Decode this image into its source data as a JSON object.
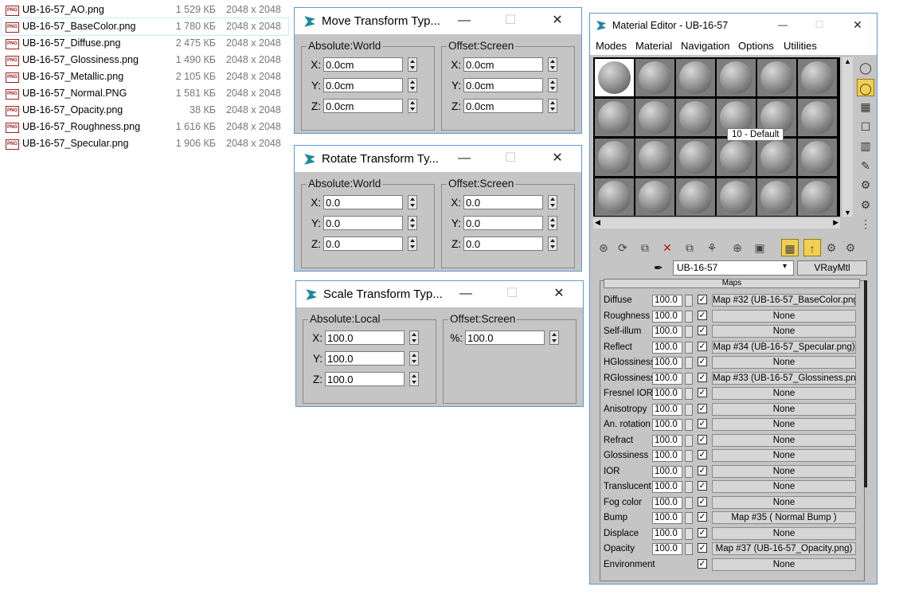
{
  "files": [
    {
      "icon": "png-file-icon",
      "name": "UB-16-57_AO.png",
      "size": "1 529 КБ",
      "dim": "2048 x 2048"
    },
    {
      "icon": "png-file-icon",
      "name": "UB-16-57_BaseColor.png",
      "size": "1 780 КБ",
      "dim": "2048 x 2048"
    },
    {
      "icon": "png-file-icon",
      "name": "UB-16-57_Diffuse.png",
      "size": "2 475 КБ",
      "dim": "2048 x 2048"
    },
    {
      "icon": "png-file-icon",
      "name": "UB-16-57_Glossiness.png",
      "size": "1 490 КБ",
      "dim": "2048 x 2048"
    },
    {
      "icon": "png-file-icon",
      "name": "UB-16-57_Metallic.png",
      "size": "2 105 КБ",
      "dim": "2048 x 2048"
    },
    {
      "icon": "png-file-icon",
      "name": "UB-16-57_Normal.PNG",
      "size": "1 581 КБ",
      "dim": "2048 x 2048"
    },
    {
      "icon": "png-file-icon",
      "name": "UB-16-57_Opacity.png",
      "size": "38 КБ",
      "dim": "2048 x 2048"
    },
    {
      "icon": "png-file-icon",
      "name": "UB-16-57_Roughness.png",
      "size": "1 616 КБ",
      "dim": "2048 x 2048"
    },
    {
      "icon": "png-file-icon",
      "name": "UB-16-57_Specular.png",
      "size": "1 906 КБ",
      "dim": "2048 x 2048"
    }
  ],
  "file_icon_text": "PNG",
  "window_buttons": {
    "minimize": "—",
    "maximize": "☐",
    "close": "✕"
  },
  "move": {
    "title": "Move Transform Typ...",
    "left_group": "Absolute:World",
    "right_group": "Offset:Screen",
    "left": [
      {
        "label": "X:",
        "value": "0.0cm"
      },
      {
        "label": "Y:",
        "value": "0.0cm"
      },
      {
        "label": "Z:",
        "value": "0.0cm"
      }
    ],
    "right": [
      {
        "label": "X:",
        "value": "0.0cm"
      },
      {
        "label": "Y:",
        "value": "0.0cm"
      },
      {
        "label": "Z:",
        "value": "0.0cm"
      }
    ]
  },
  "rotate": {
    "title": "Rotate Transform Ty...",
    "left_group": "Absolute:World",
    "right_group": "Offset:Screen",
    "left": [
      {
        "label": "X:",
        "value": "0.0"
      },
      {
        "label": "Y:",
        "value": "0.0"
      },
      {
        "label": "Z:",
        "value": "0.0"
      }
    ],
    "right": [
      {
        "label": "X:",
        "value": "0.0"
      },
      {
        "label": "Y:",
        "value": "0.0"
      },
      {
        "label": "Z:",
        "value": "0.0"
      }
    ]
  },
  "scale": {
    "title": "Scale Transform Typ...",
    "left_group": "Absolute:Local",
    "right_group": "Offset:Screen",
    "left": [
      {
        "label": "X:",
        "value": "100.0"
      },
      {
        "label": "Y:",
        "value": "100.0"
      },
      {
        "label": "Z:",
        "value": "100.0"
      }
    ],
    "right": [
      {
        "label": "%:",
        "value": "100.0"
      }
    ]
  },
  "material_editor": {
    "title": "Material Editor - UB-16-57",
    "menus": [
      "Modes",
      "Material",
      "Navigation",
      "Options",
      "Utilities"
    ],
    "tooltip": "10 - Default",
    "material_name": "UB-16-57",
    "material_type": "VRayMtl",
    "rollout_title": "Maps",
    "maps": [
      {
        "label": "Diffuse",
        "value": "100.0",
        "checked": "✓",
        "map": "Map #32 (UB-16-57_BaseColor.png)"
      },
      {
        "label": "Roughness",
        "value": "100.0",
        "checked": "✓",
        "map": "None"
      },
      {
        "label": "Self-illum",
        "value": "100.0",
        "checked": "✓",
        "map": "None"
      },
      {
        "label": "Reflect",
        "value": "100.0",
        "checked": "✓",
        "map": "Map #34 (UB-16-57_Specular.png)"
      },
      {
        "label": "HGlossiness",
        "value": "100.0",
        "checked": "✓",
        "map": "None"
      },
      {
        "label": "RGlossiness",
        "value": "100.0",
        "checked": "✓",
        "map": "Map #33 (UB-16-57_Glossiness.png)"
      },
      {
        "label": "Fresnel IOR",
        "value": "100.0",
        "checked": "✓",
        "map": "None"
      },
      {
        "label": "Anisotropy",
        "value": "100.0",
        "checked": "✓",
        "map": "None"
      },
      {
        "label": "An. rotation",
        "value": "100.0",
        "checked": "✓",
        "map": "None"
      },
      {
        "label": "Refract",
        "value": "100.0",
        "checked": "✓",
        "map": "None"
      },
      {
        "label": "Glossiness",
        "value": "100.0",
        "checked": "✓",
        "map": "None"
      },
      {
        "label": "IOR",
        "value": "100.0",
        "checked": "✓",
        "map": "None"
      },
      {
        "label": "Translucent",
        "value": "100.0",
        "checked": "✓",
        "map": "None"
      },
      {
        "label": "Fog color",
        "value": "100.0",
        "checked": "✓",
        "map": "None"
      },
      {
        "label": "Bump",
        "value": "100.0",
        "checked": "✓",
        "map": "Map #35  ( Normal Bump )"
      },
      {
        "label": "Displace",
        "value": "100.0",
        "checked": "✓",
        "map": "None"
      },
      {
        "label": "Opacity",
        "value": "100.0",
        "checked": "✓",
        "map": "Map #37 (UB-16-57_Opacity.png)"
      },
      {
        "label": "Environment",
        "value": "",
        "checked": "✓",
        "map": "None"
      }
    ]
  }
}
